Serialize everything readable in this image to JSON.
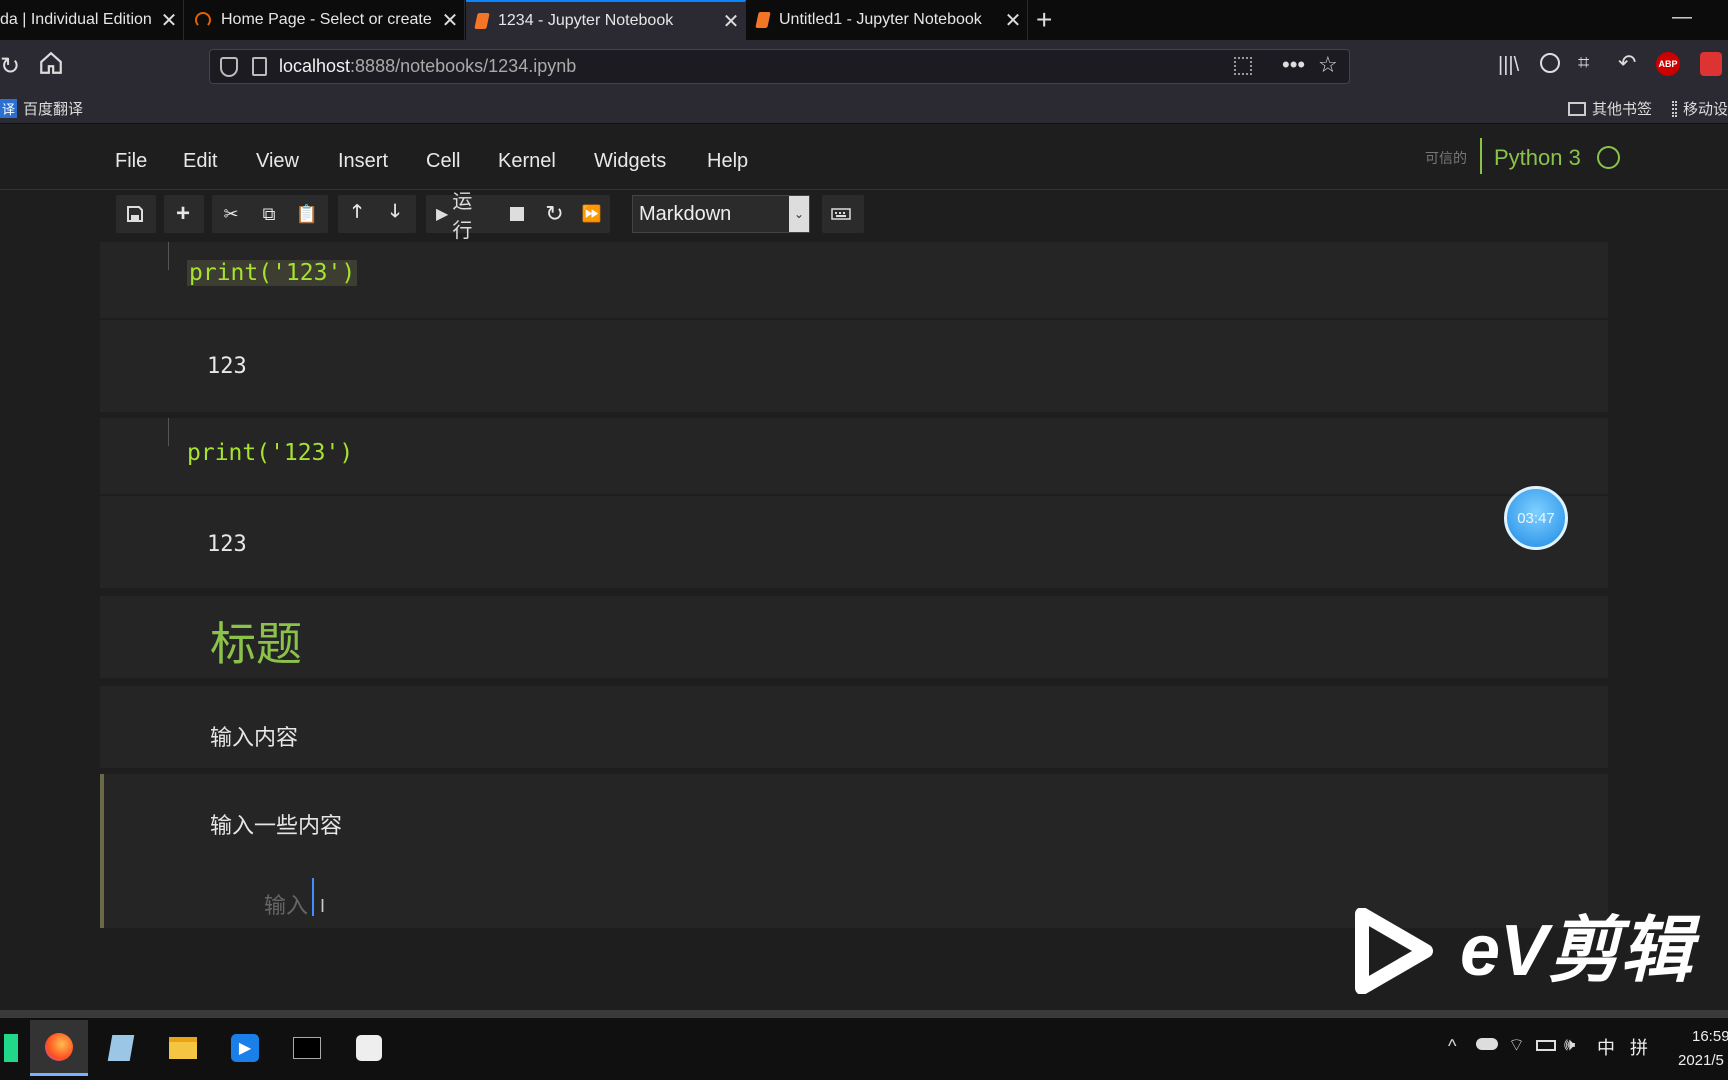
{
  "tabs": [
    {
      "title": "da | Individual Edition",
      "active": false
    },
    {
      "title": "Home Page - Select or create",
      "active": false
    },
    {
      "title": "1234 - Jupyter Notebook",
      "active": true
    },
    {
      "title": "Untitled1 - Jupyter Notebook",
      "active": false
    }
  ],
  "nav": {
    "url_host": "localhost",
    "url_rest": ":8888/notebooks/1234.ipynb"
  },
  "bookmarks": {
    "left_item": "百度翻译",
    "left_badge": "译",
    "right_item1": "其他书签",
    "right_item2": "移动设"
  },
  "jupyter": {
    "menu": [
      "File",
      "Edit",
      "View",
      "Insert",
      "Cell",
      "Kernel",
      "Widgets",
      "Help"
    ],
    "trusted": "可信的",
    "kernel": "Python 3",
    "run_label": "运行",
    "cell_type": "Markdown"
  },
  "cells": {
    "code1": "print('123')",
    "out1": "123",
    "code2": "print('123')",
    "out2": "123",
    "heading": "标题",
    "md1": "输入内容",
    "md2": "输入一些内容",
    "editing": "输入"
  },
  "overlay": {
    "timer": "03:47",
    "watermark": "eV剪辑"
  },
  "taskbar": {
    "ime1": "中",
    "ime2": "拼",
    "time": "16:59",
    "date": "2021/5"
  },
  "colors": {
    "accent": "#0a84ff",
    "code": "#a6e22e",
    "kernel": "#8bc34a",
    "heading": "#8bc34a"
  }
}
